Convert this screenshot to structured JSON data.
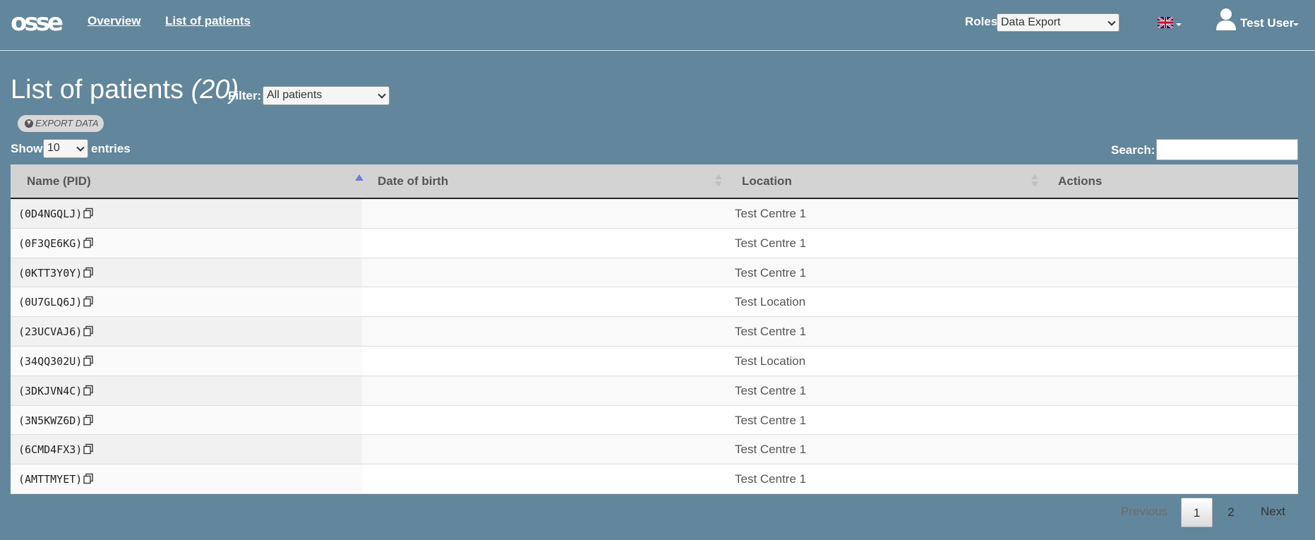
{
  "navbar": {
    "logo_text": "osse",
    "links": {
      "overview": "Overview",
      "patients": "List of patients"
    },
    "roles_label": "Roles",
    "roles_selected": "Data Export",
    "language_icon": "uk-flag-icon",
    "user_icon": "user-icon",
    "user_name": "Test User"
  },
  "header": {
    "title": "List of patients",
    "count": "(20)",
    "filter_label": "Filter:",
    "filter_selected": "All patients",
    "export_label": "EXPORT DATA"
  },
  "table_controls": {
    "show_label": "Show",
    "entries_selected": "10",
    "entries_label": "entries",
    "search_label": "Search:",
    "search_value": ""
  },
  "table": {
    "columns": [
      "Name (PID)",
      "Date of birth",
      "Location",
      "Actions"
    ],
    "rows": [
      {
        "pid": "(0D4NGQLJ)",
        "dob": "",
        "location": "Test Centre 1"
      },
      {
        "pid": "(0F3QE6KG)",
        "dob": "",
        "location": "Test Centre 1"
      },
      {
        "pid": "(0KTT3Y0Y)",
        "dob": "",
        "location": "Test Centre 1"
      },
      {
        "pid": "(0U7GLQ6J)",
        "dob": "",
        "location": "Test Location"
      },
      {
        "pid": "(23UCVAJ6)",
        "dob": "",
        "location": "Test Centre 1"
      },
      {
        "pid": "(34QQ302U)",
        "dob": "",
        "location": "Test Location"
      },
      {
        "pid": "(3DKJVN4C)",
        "dob": "",
        "location": "Test Centre 1"
      },
      {
        "pid": "(3N5KWZ6D)",
        "dob": "",
        "location": "Test Centre 1"
      },
      {
        "pid": "(6CMD4FX3)",
        "dob": "",
        "location": "Test Centre 1"
      },
      {
        "pid": "(AMTTMYET)",
        "dob": "",
        "location": "Test Centre 1"
      }
    ]
  },
  "pagination": {
    "previous": "Previous",
    "pages": [
      "1",
      "2"
    ],
    "next": "Next"
  },
  "colors": {
    "background": "#62869b",
    "header_row": "#d3d3d3",
    "sort_active": "#6f7dd6"
  }
}
